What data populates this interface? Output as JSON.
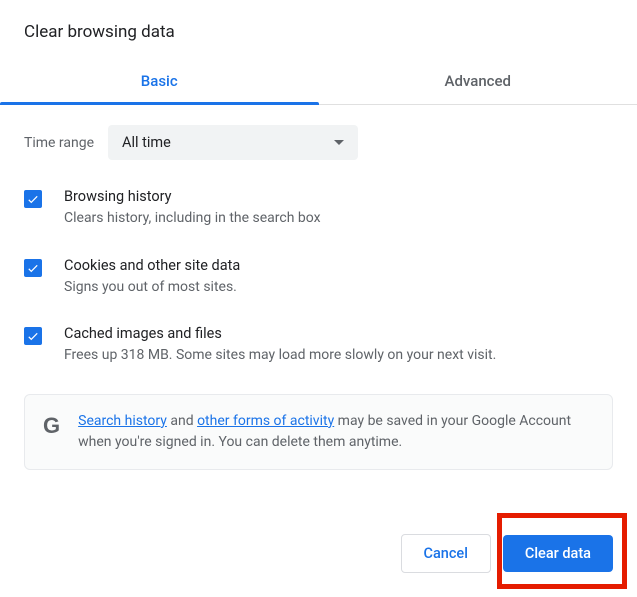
{
  "title": "Clear browsing data",
  "tabs": {
    "basic": "Basic",
    "advanced": "Advanced"
  },
  "time": {
    "label": "Time range",
    "value": "All time"
  },
  "options": [
    {
      "title": "Browsing history",
      "sub": "Clears history, including in the search box"
    },
    {
      "title": "Cookies and other site data",
      "sub": "Signs you out of most sites."
    },
    {
      "title": "Cached images and files",
      "sub": "Frees up 318 MB. Some sites may load more slowly on your next visit."
    }
  ],
  "info": {
    "link1": "Search history",
    "mid1": " and ",
    "link2": "other forms of activity",
    "rest": " may be saved in your Google Account when you're signed in. You can delete them anytime."
  },
  "buttons": {
    "cancel": "Cancel",
    "clear": "Clear data"
  }
}
